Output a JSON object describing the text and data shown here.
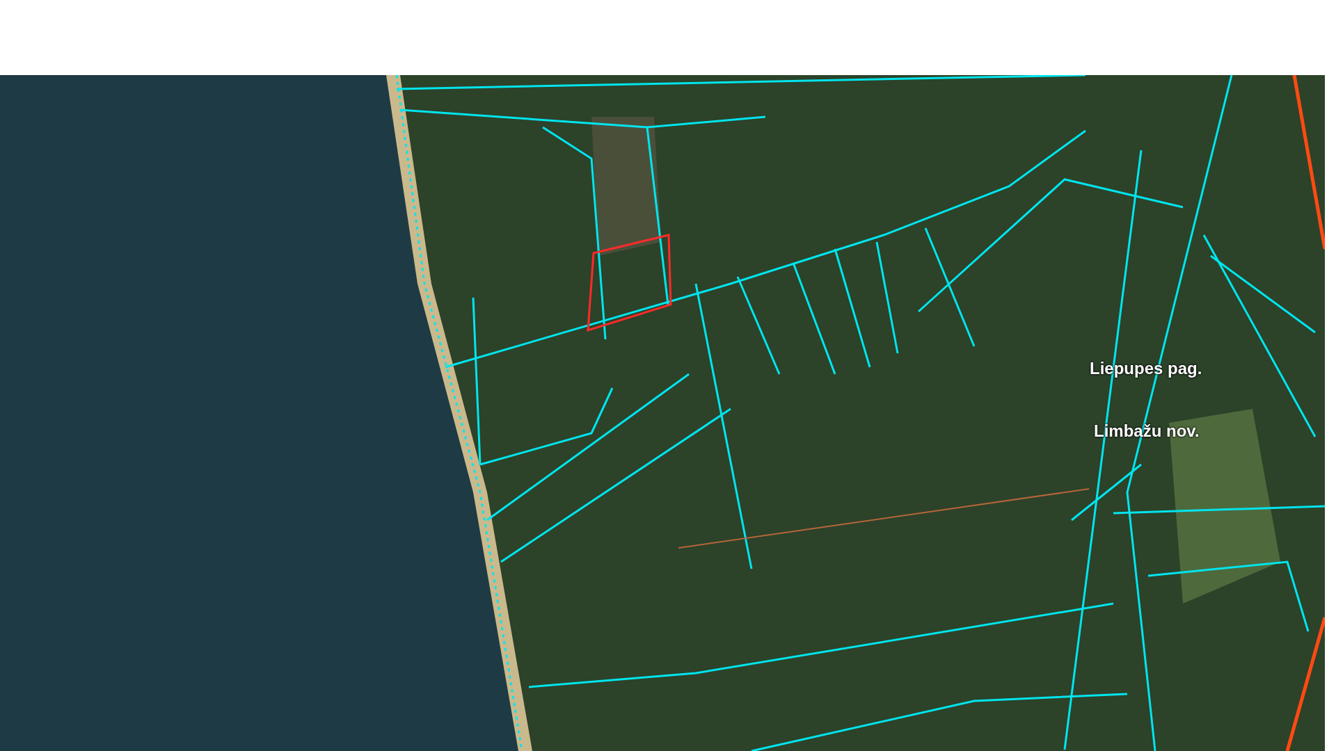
{
  "map": {
    "labels": [
      {
        "text": "Liepupes pag."
      },
      {
        "text": "Limbažu nov."
      }
    ]
  }
}
